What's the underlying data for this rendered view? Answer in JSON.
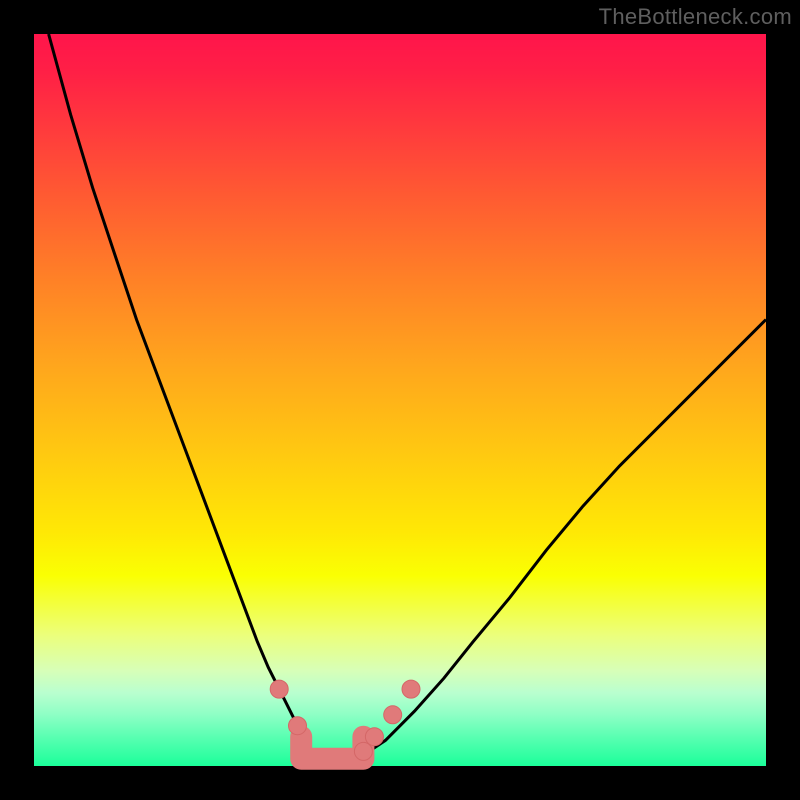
{
  "watermark": "TheBottleneck.com",
  "colors": {
    "background": "#000000",
    "gradient_top": "#ff154b",
    "gradient_bottom": "#1bff9a",
    "curve": "#000000",
    "marker": "#e07a7a"
  },
  "chart_data": {
    "type": "line",
    "title": "",
    "xlabel": "",
    "ylabel": "",
    "xlim": [
      0,
      100
    ],
    "ylim": [
      0,
      100
    ],
    "grid": false,
    "legend": false,
    "series": [
      {
        "name": "bottleneck-curve",
        "x": [
          2,
          5,
          8,
          11,
          14,
          17,
          20,
          23,
          26,
          27.5,
          29,
          30.5,
          32,
          33.5,
          35,
          36,
          37,
          38,
          40,
          42.5,
          45,
          48,
          52,
          56,
          60,
          65,
          70,
          75,
          80,
          85,
          90,
          95,
          100
        ],
        "y": [
          100,
          89,
          79,
          70,
          61,
          53,
          45,
          37,
          29,
          25,
          21,
          17,
          13.5,
          10.5,
          7.5,
          5.5,
          3.5,
          1.5,
          0.5,
          0.5,
          1.5,
          3.5,
          7.5,
          12,
          17,
          23,
          29.5,
          35.5,
          41,
          46,
          51,
          56,
          61
        ]
      }
    ],
    "markers": [
      {
        "x": 33.5,
        "y": 10.5
      },
      {
        "x": 36.0,
        "y": 5.5
      },
      {
        "x": 45.0,
        "y": 2.0
      },
      {
        "x": 46.5,
        "y": 4.0
      },
      {
        "x": 49.0,
        "y": 7.0
      },
      {
        "x": 51.5,
        "y": 10.5
      }
    ],
    "highlight_segment": {
      "from_x": 36.5,
      "to_x": 45.0,
      "y": 1.0
    }
  }
}
